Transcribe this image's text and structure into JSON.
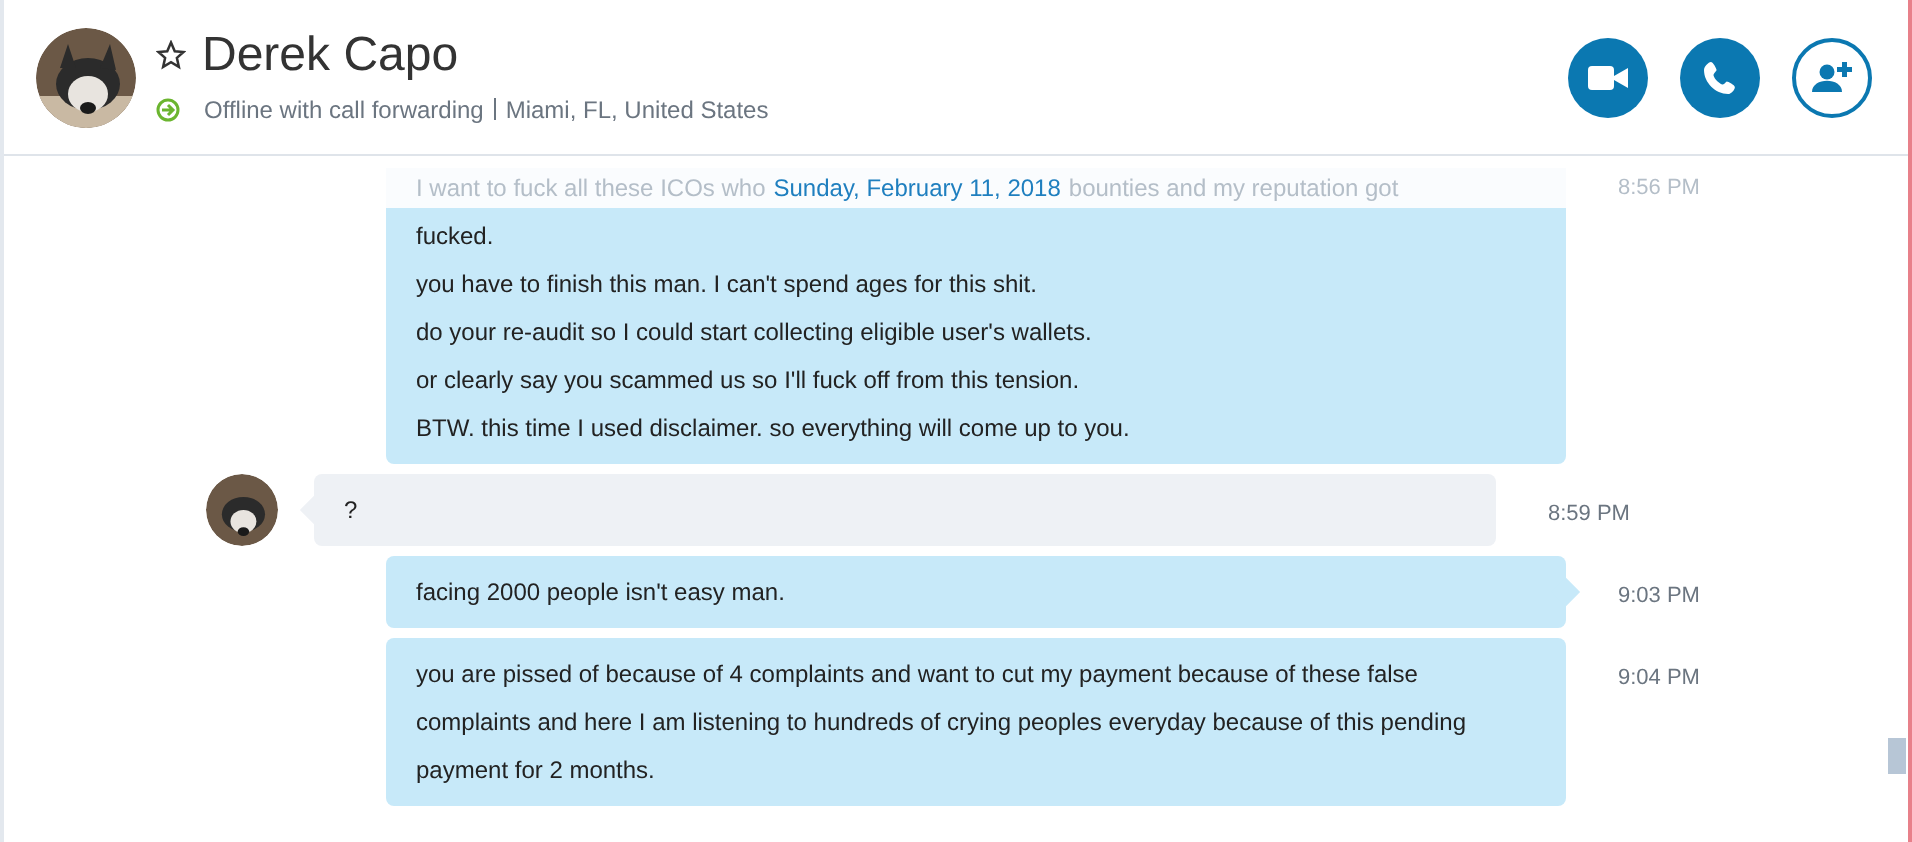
{
  "contact": {
    "name": "Derek Capo",
    "favorite": false,
    "status": "Offline with call forwarding",
    "location": "Miami, FL, United States"
  },
  "actions": [
    {
      "kind": "video"
    },
    {
      "kind": "call"
    },
    {
      "kind": "add"
    }
  ],
  "date_header": {
    "text": "Sunday, February 11, 2018",
    "obscured_before": "I want to fuck all these ICOs who",
    "obscured_after": "bounties and my reputation got",
    "obscured_time": "8:56 PM"
  },
  "messages": [
    {
      "kind": "outgoing",
      "lines": [
        "fucked.",
        "you have to finish this man. I can't spend ages for this shit.",
        "do your re-audit so I could start collecting eligible user's wallets.",
        "or clearly say you scammed us so I'll fuck off from this tension.",
        "BTW. this time I used disclaimer. so everything will come up to you."
      ]
    },
    {
      "kind": "incoming",
      "lines": [
        "?"
      ],
      "time": "8:59 PM",
      "tail": true
    },
    {
      "kind": "outgoing",
      "lines": [
        "facing 2000 people isn't easy man."
      ],
      "time": "9:03 PM",
      "tail": true
    },
    {
      "kind": "outgoing",
      "lines": [
        "you are pissed of because of 4 complaints and want to cut my payment because of these false complaints and here I am listening to hundreds of crying peoples everyday because of this pending payment for 2 months."
      ],
      "time": "9:04 PM"
    }
  ]
}
